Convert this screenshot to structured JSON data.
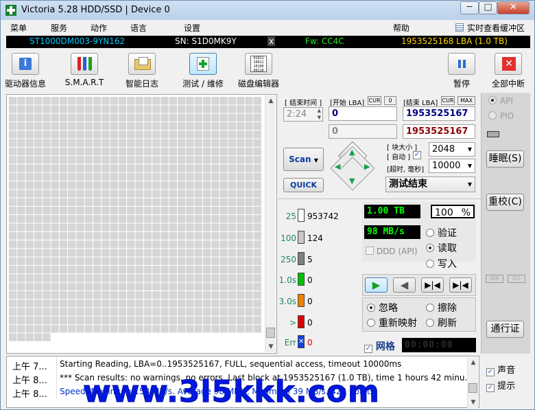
{
  "window": {
    "title": "Victoria 5.28 HDD/SSD | Device 0",
    "min_label": "─",
    "max_label": "□",
    "close_label": "✕"
  },
  "menu": {
    "items": [
      "菜单",
      "服务",
      "动作",
      "语言",
      "设置",
      "帮助"
    ],
    "realtime_label": "实时查看缓冲区"
  },
  "infobar": {
    "model": "ST1000DM003-9YN162",
    "serial": "SN: S1D0MK9Y",
    "close_x": "x",
    "firmware": "Fw: CC4C",
    "lba": "1953525168 LBA (1.0 TB)"
  },
  "toolbar": {
    "drive_info": "驱动器信息",
    "smart": "S.M.A.R.T",
    "smart_log": "智能日志",
    "test_repair": "测试 / 维修",
    "disk_editor": "磁盘编辑器",
    "pause": "暂停",
    "abort_all": "全部中断"
  },
  "scan": {
    "end_time_label": "[ 结束时间 ]",
    "end_time": "2:24",
    "start_lba_label": "[开始 LBA]",
    "cur_label": "CUR",
    "zero_label": "0",
    "end_lba_label": "[结束 LBA]",
    "max_label": "MAX",
    "start_lba": "0",
    "end_lba": "1953525167",
    "cur_lba": "0",
    "cur_end_lba": "1953525167",
    "block_size_label": "[ 块大小 ]",
    "auto_label": "[ 自动 ]",
    "block_size": "2048",
    "timeout_label": "[超时, 毫秒]",
    "timeout": "10000",
    "scan_button": "Scan",
    "quick_button": "QUICK",
    "status": "测试结束"
  },
  "stats": [
    {
      "label": "25",
      "value": "953742",
      "color": "#ffffff"
    },
    {
      "label": "100",
      "value": "124",
      "color": "#c8c8c8"
    },
    {
      "label": "250",
      "value": "5",
      "color": "#808080"
    },
    {
      "label": "1.0s",
      "value": "0",
      "color": "#00c000"
    },
    {
      "label": "3.0s",
      "value": "0",
      "color": "#f08000"
    },
    {
      "label": ">",
      "value": "0",
      "color": "#e00000"
    },
    {
      "label": "Err",
      "value": "0",
      "color": "#1040e0"
    }
  ],
  "progress": {
    "size": "1.00 TB",
    "percent": "100",
    "percent_unit": "%",
    "speed": "98 MB/s",
    "ddd_label": "DDD (API)",
    "timer": "00:00:00",
    "grid_label": "网格"
  },
  "modes": {
    "verify": "验证",
    "read": "读取",
    "write": "写入"
  },
  "actions": {
    "ignore": "忽略",
    "erase": "擦除",
    "remap": "重新映射",
    "refresh": "刷新"
  },
  "sidebar": {
    "api": "API",
    "pio": "PIO",
    "sleep": "睡眠(S)",
    "recalibrate": "重校(C)",
    "wr": "WR",
    "rd": "RD",
    "passport": "通行证",
    "sound": "声音",
    "hints": "提示"
  },
  "log": [
    {
      "time": "上午 7...",
      "msg": "Starting Reading, LBA=0..1953525167, FULL, sequential access, timeout 10000ms",
      "color": "#000000"
    },
    {
      "time": "上午 8...",
      "msg": "*** Scan results: no warnings, no errors. Last block at 1953525167 (1.0 TB), time 1 hours 42 minu...",
      "color": "#000000"
    },
    {
      "time": "上午 8...",
      "msg": "Speed: Maximum 158 MB/s. Average 98 MB/s. Minimum 39 MB/s. 423 points",
      "color": "#0033cc"
    }
  ],
  "watermark": "www.3l5kkk.com",
  "grid": {
    "cols": 30,
    "rows": 29,
    "last_row_filled": 5
  }
}
